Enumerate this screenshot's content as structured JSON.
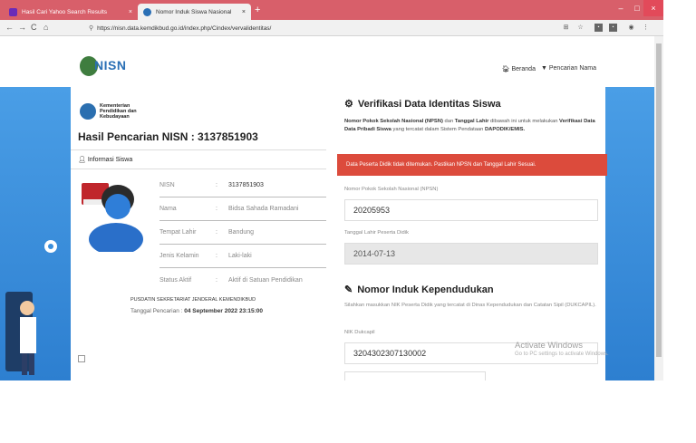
{
  "browser": {
    "tabs": [
      {
        "label": "Hasil Cari Yahoo Search Results",
        "active": false
      },
      {
        "label": "Nomor Induk Siswa Nasional",
        "active": true
      }
    ],
    "new_tab": "+",
    "close_symbol": "×",
    "window_controls": [
      "–",
      "□",
      "×"
    ],
    "url": "https://nisn.data.kemdikbud.go.id/index.php/Cindex/vervalidentitas/"
  },
  "header": {
    "logo_text": "NISN",
    "nav": [
      {
        "label": "Beranda",
        "icon": "home-icon"
      },
      {
        "label": "Pencarian Nama",
        "icon": "filter-icon"
      }
    ]
  },
  "ministry": {
    "line1": "Kementerian",
    "line2": "Pendidikan dan",
    "line3": "Kebudayaan"
  },
  "result": {
    "title": "Hasil Pencarian NISN : 3137851903",
    "section_label": "Informasi Siswa",
    "fields": [
      {
        "key": "NISN",
        "sep": ":",
        "value": "3137851903"
      },
      {
        "key": "Nama",
        "sep": ":",
        "value": "Bidsa Sahada Ramadani"
      },
      {
        "key": "Tempat Lahir",
        "sep": ":",
        "value": "Bandung"
      },
      {
        "key": "Jenis Kelamin",
        "sep": ":",
        "value": "Laki-laki"
      },
      {
        "key": "Status Aktif",
        "sep": ":",
        "value": "Aktif di Satuan Pendidikan"
      }
    ],
    "footer_org": "PUSDATIN SEKRETARIAT JENDERAL KEMENDIKBUD",
    "footer_date_label": "Tanggal Pencarian : ",
    "footer_date": "04 September 2022 23:15:00"
  },
  "verify": {
    "title": "Verifikasi Data Identitas Siswa",
    "desc_a": "Nomor Pokok Sekolah Nasional (NPSN)",
    "desc_b": " dan ",
    "desc_c": "Tanggal Lahir",
    "desc_d": " dibawah ini untuk melakukan ",
    "desc_e": "Verifikasi Data Data Pribadi Siswa",
    "desc_f": " yang tercatat dalam Sistem Pendataan ",
    "desc_g": "DAPODIK/EMIS.",
    "alert": "Data Peserta Didik tidak ditemukan. Pastikan NPSN dan Tanggal Lahir Sesuai.",
    "npsn_label": "Nomor Pokok Sekolah Nasional (NPSN)",
    "npsn_value": "20205953",
    "dob_label": "Tanggal Lahir Peserta Didik",
    "dob_value": "2014-07-13"
  },
  "nik": {
    "title": "Nomor Induk Kependudukan",
    "desc": "Silahkan masukkan NIK Peserta Didik yang tercatat di Dinas Kependudukan dan Catatan Sipil (DUKCAPIL).",
    "label": "NIK Dukcapil",
    "value": "3204302307130002"
  },
  "watermark": {
    "line1": "Activate Windows",
    "line2": "Go to PC settings to activate Windows."
  },
  "colors": {
    "tabbar": "#d85f6a",
    "alert": "#dc4b3c",
    "band": "#3a8fdc",
    "brand": "#2a6fb5"
  }
}
